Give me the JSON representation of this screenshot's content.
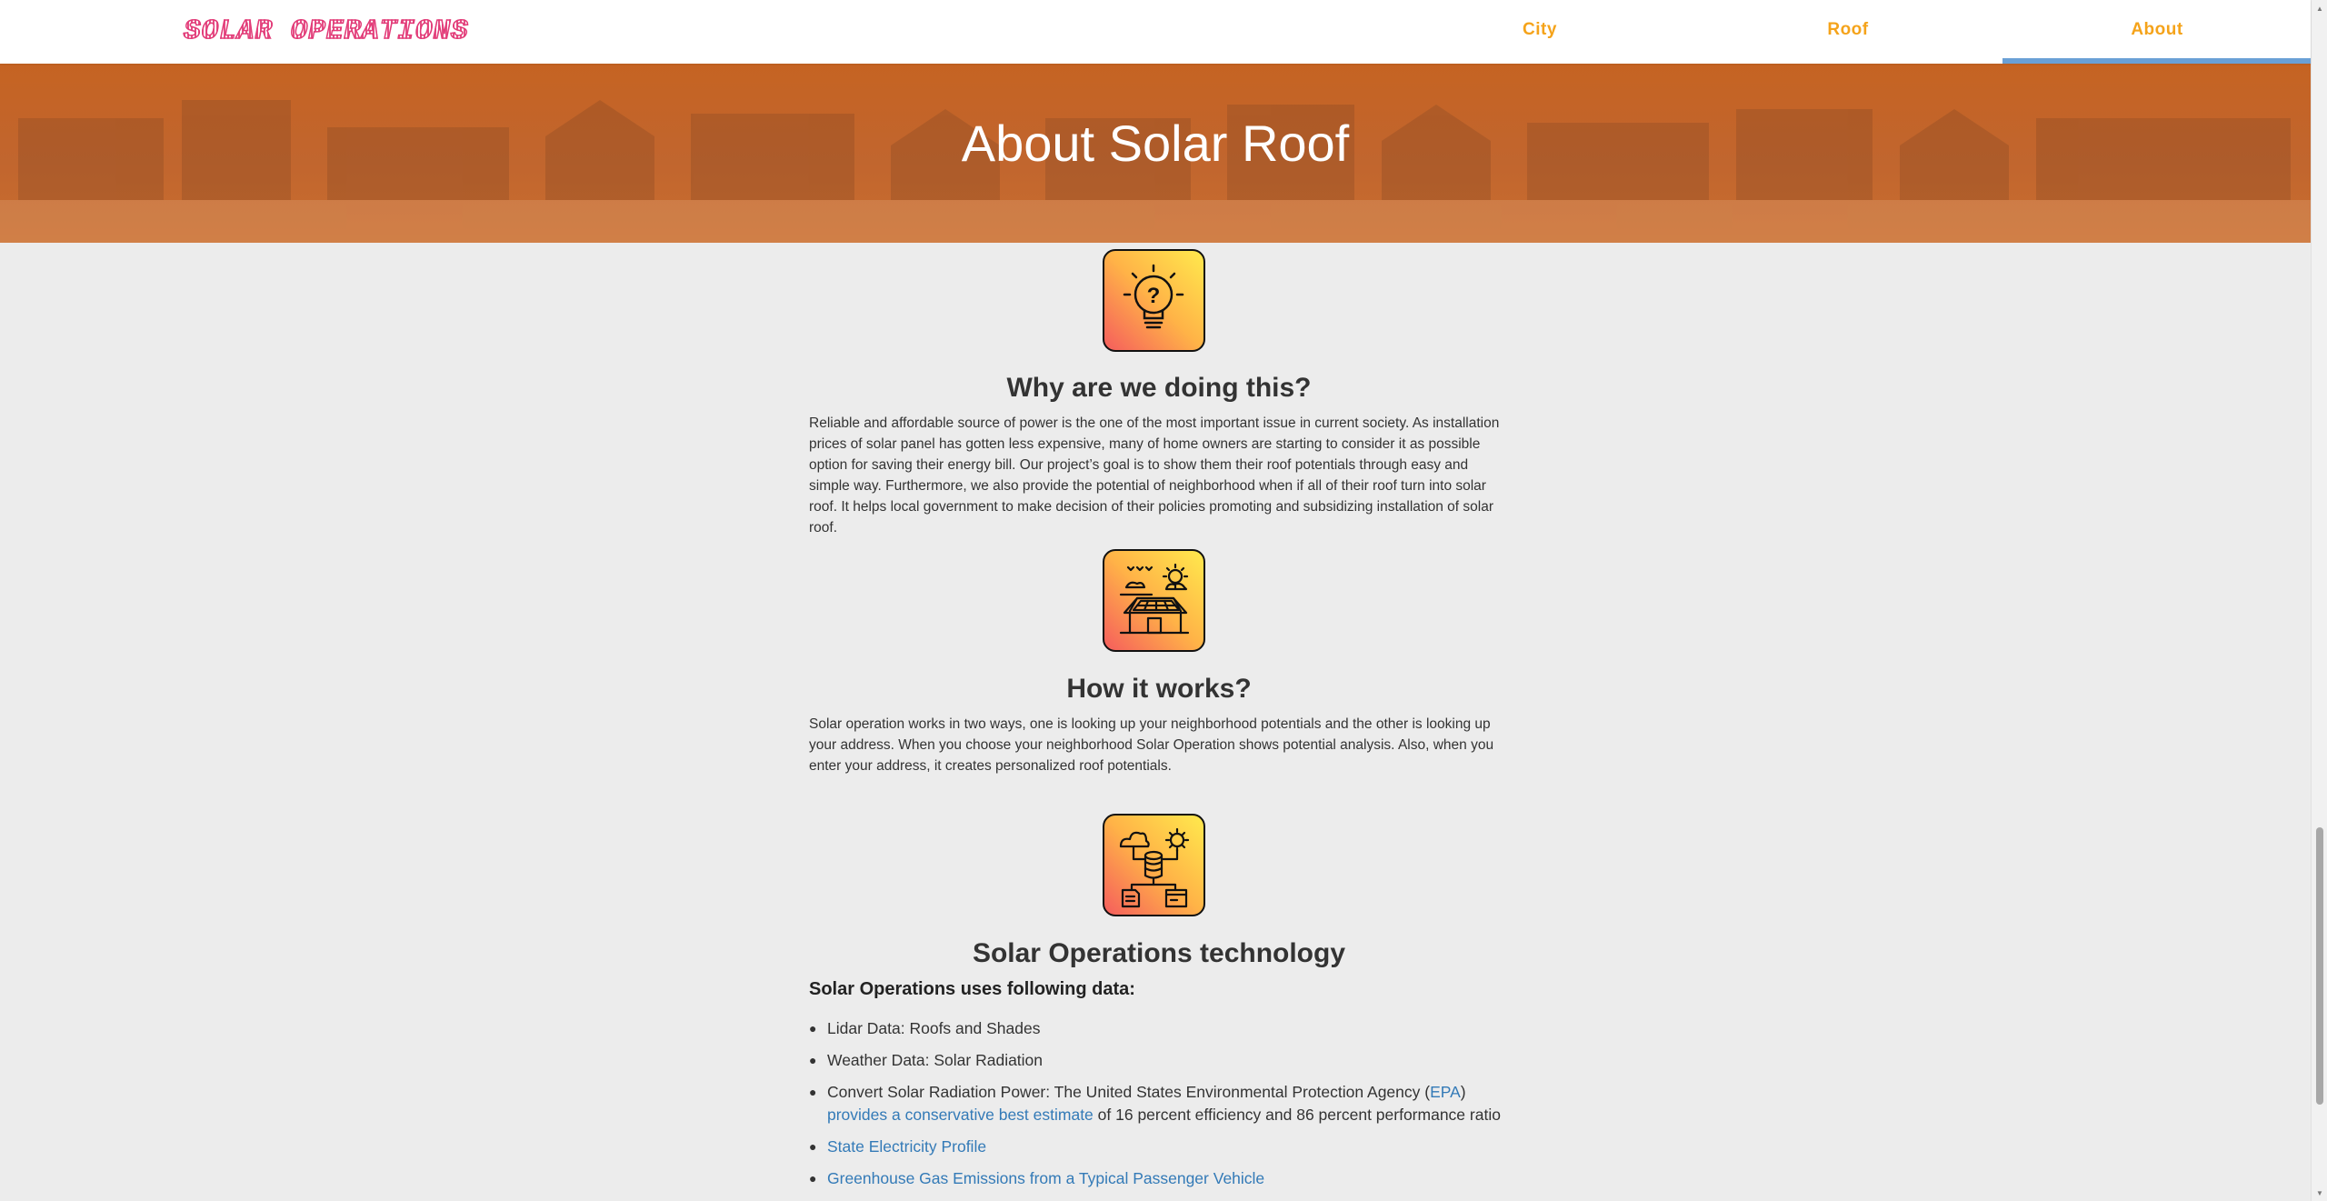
{
  "brand": {
    "name": "SOLAR OPERATIONS"
  },
  "nav": {
    "items": [
      {
        "label": "City"
      },
      {
        "label": "Roof"
      },
      {
        "label": "About",
        "active": true
      }
    ],
    "active_color": "#6aa0d6",
    "item_color": "#f5a31a"
  },
  "hero": {
    "title": "About Solar Roof"
  },
  "sections": {
    "why": {
      "icon": "lightbulb-question-icon",
      "title": "Why are we doing this?",
      "text": "Reliable and affordable source of power is the one of the most important issue in current society. As installation prices of solar panel has gotten less expensive, many of home owners are starting to consider it as possible option for saving their energy bill. Our project’s goal is to show them their roof potentials through easy and simple way. Furthermore, we also provide the potential of neighborhood when if all of their roof turn into solar roof. It helps local government to make decision of their policies promoting and subsidizing installation of solar roof."
    },
    "how": {
      "icon": "solar-house-icon",
      "title": "How it works?",
      "text": "Solar operation works in two ways, one is looking up your neighborhood potentials and the other is looking up your address. When you choose your neighborhood Solar Operation shows potential analysis. Also, when you enter your address, it creates personalized roof potentials."
    },
    "tech": {
      "icon": "data-network-icon",
      "title": "Solar Operations technology",
      "subtitle": "Solar Operations uses following data:",
      "items": {
        "lidar": "Lidar Data: Roofs and Shades",
        "weather": "Weather Data: Solar Radiation",
        "convert_pre": "Convert Solar Radiation Power: The United States Environmental Protection Agency (",
        "epa_link": "EPA",
        "convert_mid": ")",
        "estimate_link": "provides a conservative best estimate",
        "convert_post": " of 16 percent efficiency and 86 percent performance ratio",
        "state_link": "State Electricity Profile",
        "ghg_link": "Greenhouse Gas Emissions from a Typical Passenger Vehicle"
      }
    }
  }
}
